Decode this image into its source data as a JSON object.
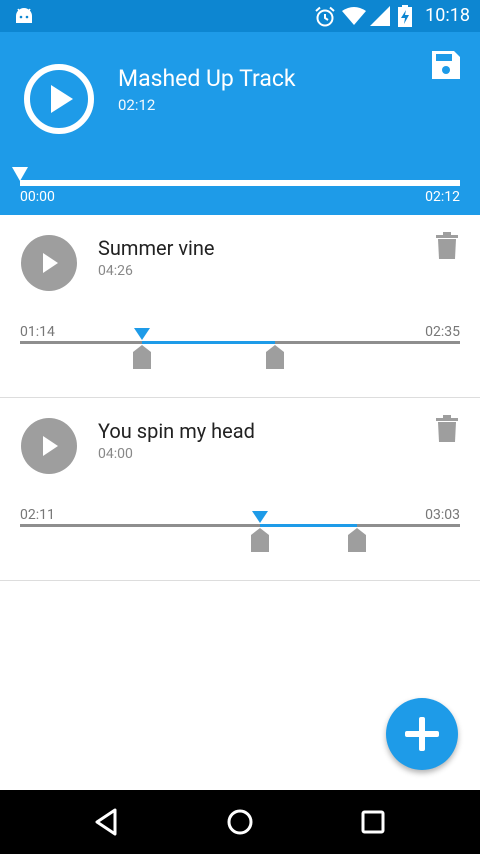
{
  "status_bar": {
    "time": "10:18"
  },
  "mix": {
    "title": "Mashed Up Track",
    "duration": "02:12",
    "start": "00:00",
    "end": "02:12",
    "progress": 0
  },
  "clips": [
    {
      "title": "Summer vine",
      "duration": "04:26",
      "start_label": "01:14",
      "end_label": "02:35",
      "marker_fraction": 0.278,
      "sel_start": 0.278,
      "sel_end": 0.58
    },
    {
      "title": "You spin my head",
      "duration": "04:00",
      "start_label": "02:11",
      "end_label": "03:03",
      "marker_fraction": 0.545,
      "sel_start": 0.545,
      "sel_end": 0.765
    }
  ],
  "icons": {
    "status": [
      "android-icon",
      "alarm-icon",
      "wifi-icon",
      "signal-icon",
      "battery-icon"
    ],
    "header": [
      "play-icon",
      "save-icon"
    ],
    "clip": [
      "play-icon",
      "trash-icon"
    ],
    "fab": "plus-icon",
    "nav": [
      "back-icon",
      "home-icon",
      "recents-icon"
    ]
  },
  "colors": {
    "primary": "#1e9be8",
    "status_bar": "#0d86d1",
    "gray": "#9e9e9e",
    "nav_bar": "#000000"
  }
}
